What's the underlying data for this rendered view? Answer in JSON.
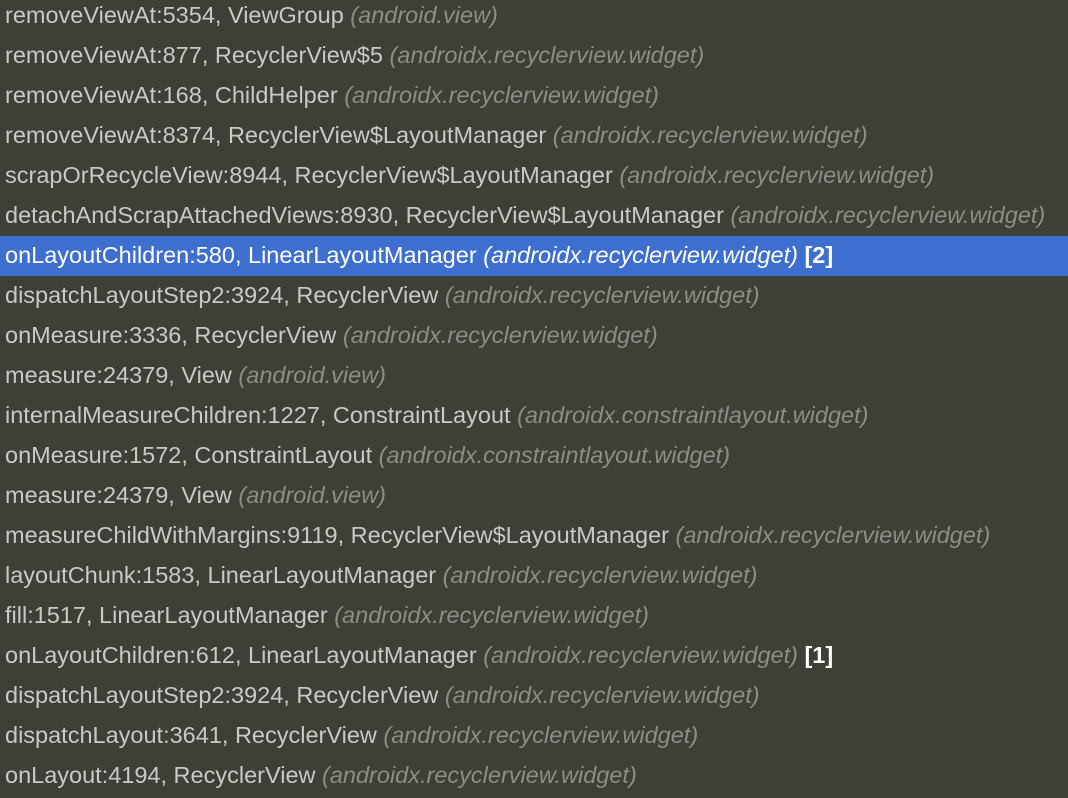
{
  "frames": [
    {
      "method": "removeViewAt:5354, ViewGroup",
      "package": "(android.view)",
      "badge": ""
    },
    {
      "method": "removeViewAt:877, RecyclerView$5",
      "package": "(androidx.recyclerview.widget)",
      "badge": ""
    },
    {
      "method": "removeViewAt:168, ChildHelper",
      "package": "(androidx.recyclerview.widget)",
      "badge": ""
    },
    {
      "method": "removeViewAt:8374, RecyclerView$LayoutManager",
      "package": "(androidx.recyclerview.widget)",
      "badge": ""
    },
    {
      "method": "scrapOrRecycleView:8944, RecyclerView$LayoutManager",
      "package": "(androidx.recyclerview.widget)",
      "badge": ""
    },
    {
      "method": "detachAndScrapAttachedViews:8930, RecyclerView$LayoutManager",
      "package": "(androidx.recyclerview.widget)",
      "badge": ""
    },
    {
      "method": "onLayoutChildren:580, LinearLayoutManager",
      "package": "(androidx.recyclerview.widget)",
      "badge": "[2]",
      "selected": true
    },
    {
      "method": "dispatchLayoutStep2:3924, RecyclerView",
      "package": "(androidx.recyclerview.widget)",
      "badge": ""
    },
    {
      "method": "onMeasure:3336, RecyclerView",
      "package": "(androidx.recyclerview.widget)",
      "badge": ""
    },
    {
      "method": "measure:24379, View",
      "package": "(android.view)",
      "badge": ""
    },
    {
      "method": "internalMeasureChildren:1227, ConstraintLayout",
      "package": "(androidx.constraintlayout.widget)",
      "badge": ""
    },
    {
      "method": "onMeasure:1572, ConstraintLayout",
      "package": "(androidx.constraintlayout.widget)",
      "badge": ""
    },
    {
      "method": "measure:24379, View",
      "package": "(android.view)",
      "badge": ""
    },
    {
      "method": "measureChildWithMargins:9119, RecyclerView$LayoutManager",
      "package": "(androidx.recyclerview.widget)",
      "badge": ""
    },
    {
      "method": "layoutChunk:1583, LinearLayoutManager",
      "package": "(androidx.recyclerview.widget)",
      "badge": ""
    },
    {
      "method": "fill:1517, LinearLayoutManager",
      "package": "(androidx.recyclerview.widget)",
      "badge": ""
    },
    {
      "method": "onLayoutChildren:612, LinearLayoutManager",
      "package": "(androidx.recyclerview.widget)",
      "badge": "[1]"
    },
    {
      "method": "dispatchLayoutStep2:3924, RecyclerView",
      "package": "(androidx.recyclerview.widget)",
      "badge": ""
    },
    {
      "method": "dispatchLayout:3641, RecyclerView",
      "package": "(androidx.recyclerview.widget)",
      "badge": ""
    },
    {
      "method": "onLayout:4194, RecyclerView",
      "package": "(androidx.recyclerview.widget)",
      "badge": ""
    }
  ]
}
